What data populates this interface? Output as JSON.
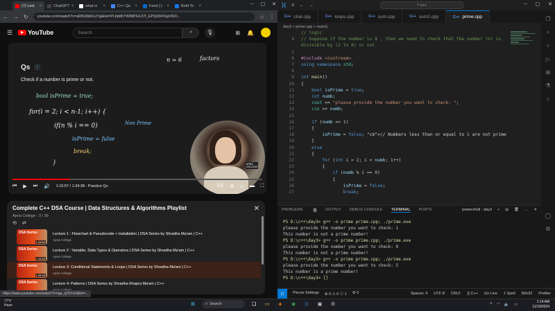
{
  "chrome": {
    "tabs": [
      {
        "label": "(7) Lect",
        "fav": "#ff0000",
        "active": true
      },
      {
        "label": "ChatGPT",
        "fav": "#444444",
        "active": false
      },
      {
        "label": "what is",
        "fav": "#ffffff",
        "active": false
      },
      {
        "label": "C++ Qu",
        "fav": "#4285f4",
        "active": false
      },
      {
        "label": "Feed | L",
        "fav": "#0a66c2",
        "active": false
      },
      {
        "label": "Bold Te",
        "fav": "#1a73e8",
        "active": false
      }
    ],
    "url": "youtube.com/watch?v=qR9U6bKxJ7g&list=PLfqMhTWNBTe137I_EPQd34TsgV6IO...",
    "status_url": "https://www.youtube.com/watch?v=rga_rjj7kYvU&list=..."
  },
  "youtube": {
    "logo": "YouTube",
    "search_placeholder": "Search"
  },
  "video": {
    "heading": "Qs",
    "question": "Check if a number is prime or not.",
    "board_n": "n = 6",
    "board_factors": "factors",
    "chalk": {
      "line1": "bool isPrime = true;",
      "line2": "for(i = 2; i < n-1; i++) {",
      "line3": "if(n % i == 0)",
      "line4": "isPrime = false",
      "line5": "break;",
      "line6": "}",
      "note": "Non Prime"
    },
    "time": "1:15:57 / 1:34:38 · Practice Qs",
    "progress": 0.23,
    "presenter_badge": "APNA COLLEGE"
  },
  "playlist": {
    "title": "Complete C++ DSA Course | Data Structures & Algorithms Playlist",
    "subtitle": "Apna College - 3 / 39",
    "items": [
      {
        "name": "Lecture 1 : Flowchart & Pseudocode + Installation | DSA Series by Shradha Ma'am | C++",
        "channel": "Apna College",
        "duration": "1:26:52",
        "active": false
      },
      {
        "name": "Lecture 2 : Variable, Data Types & Operators | DSA Series by Shradha Ma'am | C++",
        "channel": "Apna College",
        "duration": "1:16:44",
        "active": false
      },
      {
        "name": "Lecture 3: Conditional Statements & Loops | DSA Series by Shradha Ma'am | C++",
        "channel": "Apna College",
        "duration": "1:34:39",
        "active": true
      },
      {
        "name": "Lecture 4: Patterns | DSA Series by Shradha Khapra Ma'am | C++",
        "channel": "Apna College",
        "duration": "",
        "active": false
      }
    ],
    "thumb_label": "DSA Series"
  },
  "vscode": {
    "command_center": "c++",
    "tabs": [
      {
        "label": "char.cpp",
        "active": false
      },
      {
        "label": "loops.cpp",
        "active": false
      },
      {
        "label": "sum.cpp",
        "active": false
      },
      {
        "label": "sum2.cpp",
        "active": false
      },
      {
        "label": "prime.cpp",
        "active": true
      }
    ],
    "breadcrumb": "day3 > prime.cpp > main()",
    "code_lines": [
      {
        "n": "",
        "t": "// logic"
      },
      {
        "n": "4",
        "t": "// Suppose if the number is 8 , then we need to check that the number (n) is"
      },
      {
        "n": "",
        "t": "divisible by (2 to 8) or not"
      },
      {
        "n": "5",
        "t": ""
      },
      {
        "n": "6",
        "t": "#include <iostream>"
      },
      {
        "n": "7",
        "t": "using namespace std;"
      },
      {
        "n": "8",
        "t": ""
      },
      {
        "n": "9",
        "t": "int main()"
      },
      {
        "n": "10",
        "t": "{"
      },
      {
        "n": "11",
        "t": "    bool isPrime = true;"
      },
      {
        "n": "12",
        "t": "    int numb;"
      },
      {
        "n": "13",
        "t": "    cout << \"please provide the number you want to check: \";"
      },
      {
        "n": "14",
        "t": "    cin >> numb;"
      },
      {
        "n": "15",
        "t": ""
      },
      {
        "n": "16",
        "t": "    if (numb <= 1)"
      },
      {
        "n": "17",
        "t": "    {"
      },
      {
        "n": "18",
        "t": "        isPrime = false; // Numbers less than or equal to 1 are not prime"
      },
      {
        "n": "19",
        "t": "    }"
      },
      {
        "n": "20",
        "t": "    else"
      },
      {
        "n": "21",
        "t": "    {"
      },
      {
        "n": "22",
        "t": "        for (int i = 2; i < numb; i++)"
      },
      {
        "n": "23",
        "t": "        {"
      },
      {
        "n": "24",
        "t": "            if (numb % i == 0)"
      },
      {
        "n": "25",
        "t": "            {"
      },
      {
        "n": "26",
        "t": "                isPrime = false;"
      },
      {
        "n": "27",
        "t": "                break;"
      }
    ],
    "panel_tabs": [
      "PROBLEMS",
      "OUTPUT",
      "DEBUG CONSOLE",
      "TERMINAL",
      "PORTS"
    ],
    "problems_count": "1",
    "terminal_name": "powershell - day3",
    "terminal_lines": [
      "PS D:\\c++\\day3> g++ -o prime prime.cpp; ./prime.exe",
      "please provide the number you want to check: 1",
      "This number is not a prime number!",
      "PS D:\\c++\\day3> g++ -o prime prime.cpp; ./prime.exe",
      "please provide the number you want to check: 9",
      "This number is not a prime number!",
      "PS D:\\c++\\day3> g++ -o prime prime.cpp; ./prime.exe",
      "please provide the number you want to check: 5",
      "This number is a prime number!",
      "PS D:\\c++\\day3> []"
    ],
    "status": {
      "left": [
        "Pieces Settings",
        "⊗ 0 ⚠ 0 ⓘ 1",
        "⚙ 0"
      ],
      "right": [
        "Spaces: 4",
        "UTF-8",
        "CRLF",
        "{} C++",
        "Go Live",
        "1 Spell",
        "Win32",
        "Prettier"
      ]
    }
  },
  "taskbar": {
    "weather_temp": "77°F",
    "weather_desc": "Haze",
    "search": "Search",
    "time": "1:14 AM",
    "date": "11/10/2024"
  }
}
